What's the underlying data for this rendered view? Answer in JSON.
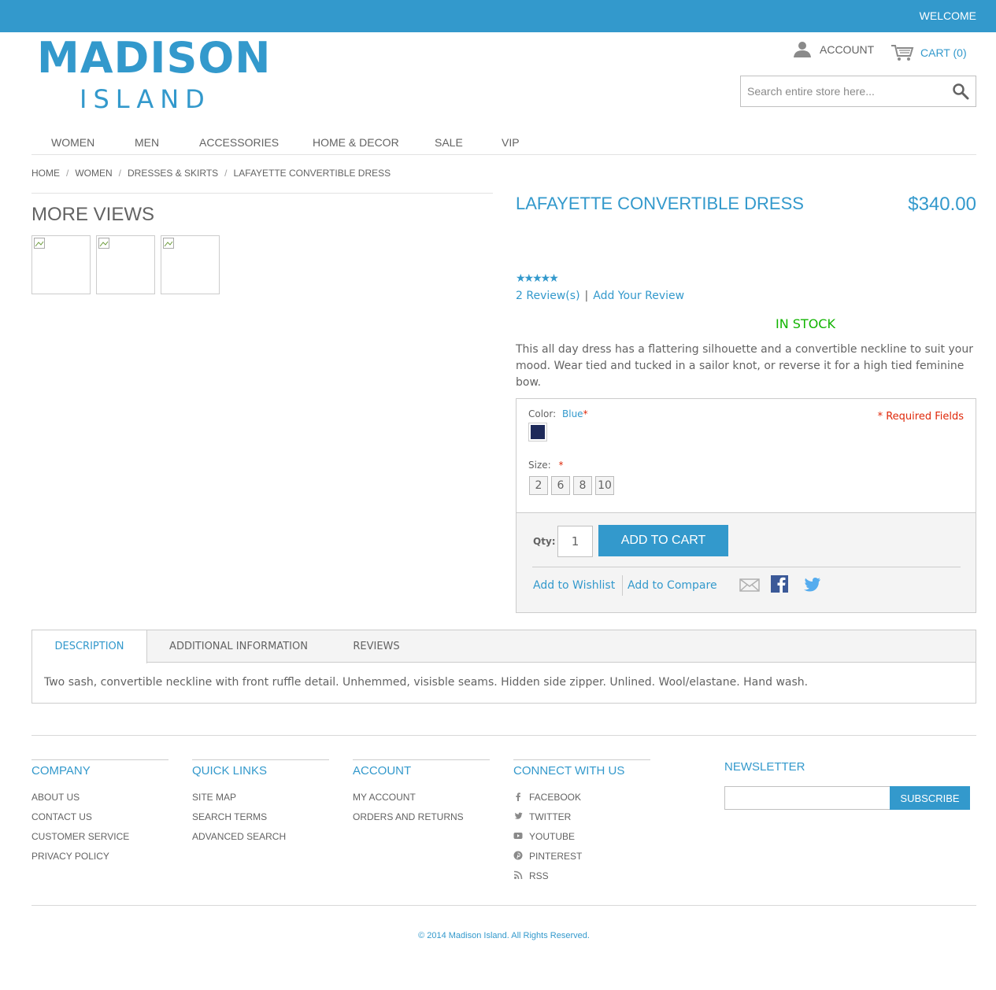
{
  "header": {
    "welcome": "WELCOME",
    "logo_main": "MADISON",
    "logo_sub": "ISLAND",
    "account_label": "ACCOUNT",
    "cart_label": "CART (0)",
    "search_placeholder": "Search entire store here...",
    "brand_color": "#3399cc"
  },
  "nav": {
    "items": [
      "WOMEN",
      "MEN",
      "ACCESSORIES",
      "HOME & DECOR",
      "SALE",
      "VIP"
    ]
  },
  "breadcrumb": [
    "HOME",
    "WOMEN",
    "DRESSES & SKIRTS",
    "LAFAYETTE CONVERTIBLE DRESS"
  ],
  "gallery": {
    "title": "MORE VIEWS",
    "thumb_count": 3
  },
  "product": {
    "name": "LAFAYETTE CONVERTIBLE DRESS",
    "price": "$340.00",
    "stars": "★★★★★",
    "rating_fraction": 1.0,
    "reviews_link": "2 Review(s)",
    "review_separator": "|",
    "add_review_link": "Add Your Review",
    "stock": "IN STOCK",
    "stock_color": "#11b400",
    "short_description": "This all day dress has a flattering silhouette and a convertible neckline to suit your mood. Wear tied and tucked in a sailor knot, or reverse it for a high tied feminine bow."
  },
  "options": {
    "color_label": "Color:",
    "color_value": "Blue",
    "required_star": "*",
    "required_fields": "* Required Fields",
    "swatch_color": "#1e2a5a",
    "size_label": "Size:",
    "sizes": [
      "2",
      "6",
      "8",
      "10"
    ]
  },
  "cart": {
    "qty_label": "Qty:",
    "qty_value": "1",
    "add_to_cart": "ADD TO CART",
    "wishlist": "Add to Wishlist",
    "compare": "Add to Compare",
    "share_icons": [
      "email-icon",
      "facebook-icon",
      "twitter-icon"
    ]
  },
  "tabs": {
    "items": [
      "DESCRIPTION",
      "ADDITIONAL INFORMATION",
      "REVIEWS"
    ],
    "active": "DESCRIPTION",
    "content": "Two sash, convertible neckline with front ruffle detail. Unhemmed, visisble seams. Hidden side zipper. Unlined. Wool/elastane. Hand wash."
  },
  "footer": {
    "company": {
      "title": "COMPANY",
      "links": [
        "ABOUT US",
        "CONTACT US",
        "CUSTOMER SERVICE",
        "PRIVACY POLICY"
      ]
    },
    "quick_links": {
      "title": "QUICK LINKS",
      "links": [
        "SITE MAP",
        "SEARCH TERMS",
        "ADVANCED SEARCH"
      ]
    },
    "account": {
      "title": "ACCOUNT",
      "links": [
        "MY ACCOUNT",
        "ORDERS AND RETURNS"
      ]
    },
    "connect": {
      "title": "CONNECT WITH US",
      "links": [
        "FACEBOOK",
        "TWITTER",
        "YOUTUBE",
        "PINTEREST",
        "RSS"
      ]
    },
    "newsletter": {
      "title": "NEWSLETTER",
      "button": "SUBSCRIBE"
    },
    "copyright": "© 2014 Madison Island. All Rights Reserved."
  }
}
